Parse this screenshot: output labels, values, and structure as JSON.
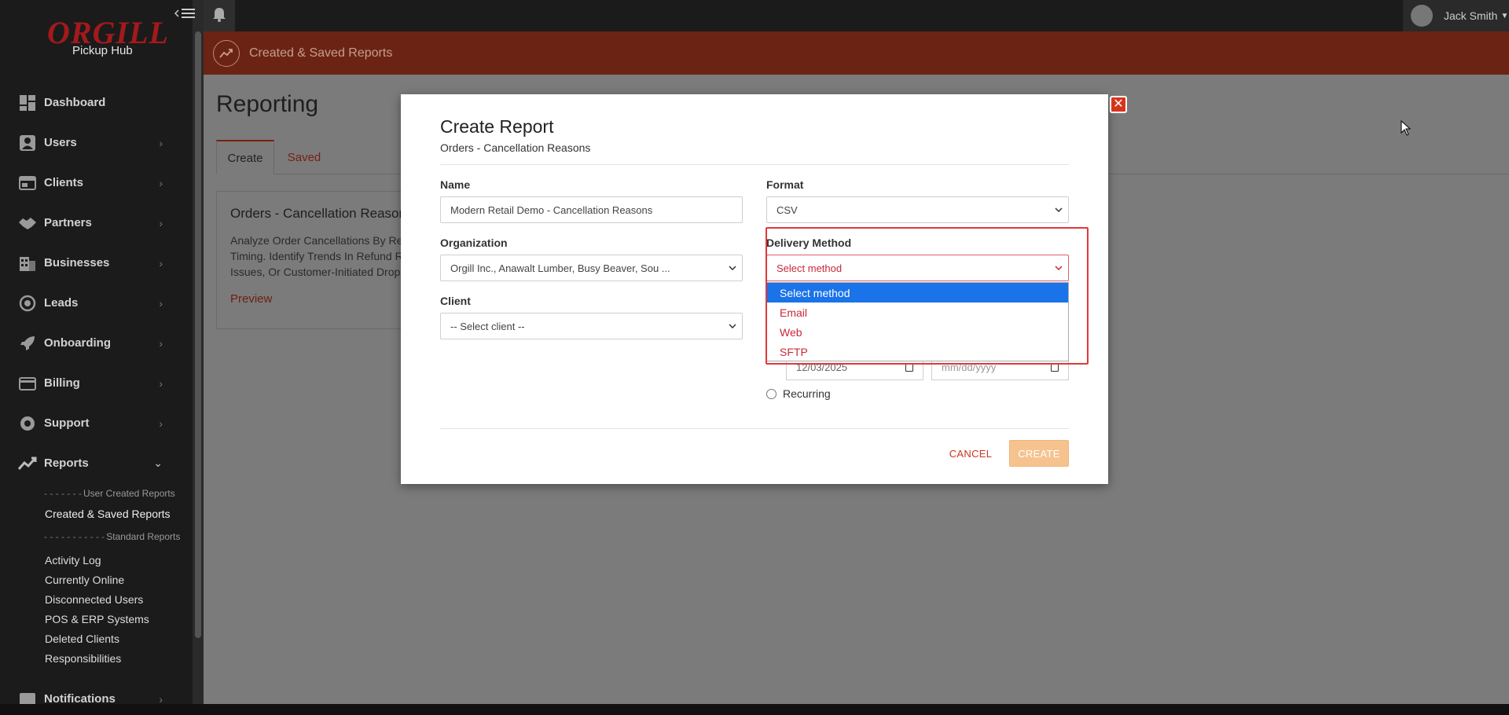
{
  "sidebar": {
    "brand": "ORGILL",
    "brand_sub": "Pickup Hub",
    "items": [
      {
        "label": "Dashboard",
        "icon": "dashboard-icon"
      },
      {
        "label": "Users",
        "icon": "user-icon"
      },
      {
        "label": "Clients",
        "icon": "clients-icon"
      },
      {
        "label": "Partners",
        "icon": "handshake-icon"
      },
      {
        "label": "Businesses",
        "icon": "building-icon"
      },
      {
        "label": "Leads",
        "icon": "target-icon"
      },
      {
        "label": "Onboarding",
        "icon": "rocket-icon"
      },
      {
        "label": "Billing",
        "icon": "card-icon"
      },
      {
        "label": "Support",
        "icon": "lifebuoy-icon"
      },
      {
        "label": "Reports",
        "icon": "chart-icon"
      },
      {
        "label": "Notifications",
        "icon": "notifications-icon"
      }
    ],
    "reports_sub": {
      "sep1": "User Created Reports",
      "active": "Created & Saved Reports",
      "sep2": "Standard Reports",
      "items": [
        "Activity Log",
        "Currently Online",
        "Disconnected Users",
        "POS & ERP Systems",
        "Deleted Clients",
        "Responsibilities"
      ]
    }
  },
  "topbar": {
    "user_name": "Jack Smith"
  },
  "banner": {
    "title": "Created & Saved Reports"
  },
  "page": {
    "title": "Reporting",
    "tabs": [
      "Create",
      "Saved"
    ]
  },
  "card": {
    "title": "Orders - Cancellation Reasons",
    "desc_lines": [
      "Analyze Order Cancellations By Re",
      "Timing. Identify Trends In Refund R",
      "Issues, Or Customer-Initiated Drop"
    ],
    "link": "Preview"
  },
  "modal": {
    "title": "Create Report",
    "subtitle": "Orders - Cancellation Reasons",
    "name_label": "Name",
    "name_value": "Modern Retail Demo - Cancellation Reasons",
    "org_label": "Organization",
    "org_value": "Orgill Inc., Anawalt Lumber, Busy Beaver, Sou ...",
    "client_label": "Client",
    "client_value": "-- Select client --",
    "format_label": "Format",
    "format_value": "CSV",
    "delivery_label": "Delivery Method",
    "delivery_value": "Select method",
    "delivery_options": [
      "Select method",
      "Email",
      "Web",
      "SFTP"
    ],
    "date_start": "12/03/2025",
    "date_end": "mm/dd/yyyy",
    "recurring_label": "Recurring",
    "cancel_label": "CANCEL",
    "create_label": "CREATE"
  },
  "colors": {
    "brand_red": "#a3191c",
    "banner": "#6b2414",
    "highlight": "#e0383b",
    "select_blue": "#1a73e8",
    "create_btn": "#f6c38f"
  }
}
